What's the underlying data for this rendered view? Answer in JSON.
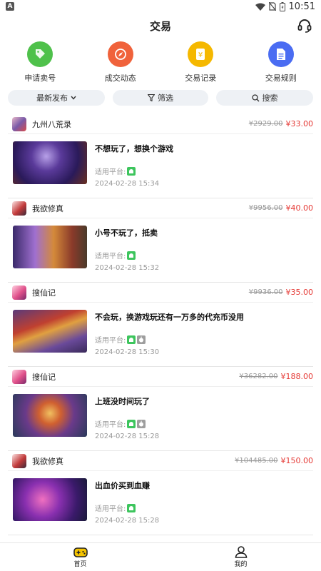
{
  "status": {
    "left_badge": "A",
    "time": "10:51"
  },
  "header": {
    "title": "交易",
    "service_icon": "headset-icon"
  },
  "quick_actions": [
    {
      "label": "申请卖号",
      "icon": "tag-icon",
      "color": "#4fc14b"
    },
    {
      "label": "成交动态",
      "icon": "compass-icon",
      "color": "#f0623b"
    },
    {
      "label": "交易记录",
      "icon": "yen-doc-icon",
      "color": "#f5b800"
    },
    {
      "label": "交易规则",
      "icon": "document-icon",
      "color": "#4a6cf2"
    }
  ],
  "filters": {
    "sort": "最新发布",
    "filter": "筛选",
    "search": "搜索"
  },
  "listings": [
    {
      "game": "九州八荒录",
      "old_price": "¥2929.00",
      "price": "¥33.00",
      "title": "不想玩了，想换个游戏",
      "platform_label": "适用平台:",
      "platforms": [
        "android"
      ],
      "date": "2024-02-28 15:34"
    },
    {
      "game": "我欲修真",
      "old_price": "¥9956.00",
      "price": "¥40.00",
      "title": "小号不玩了，抵卖",
      "platform_label": "适用平台:",
      "platforms": [
        "android"
      ],
      "date": "2024-02-28 15:32"
    },
    {
      "game": "搜仙记",
      "old_price": "¥9936.00",
      "price": "¥35.00",
      "title": "不会玩，换游戏玩还有一万多的代充币没用",
      "platform_label": "适用平台:",
      "platforms": [
        "android",
        "ios"
      ],
      "date": "2024-02-28 15:30"
    },
    {
      "game": "搜仙记",
      "old_price": "¥36282.00",
      "price": "¥188.00",
      "title": "上班没时间玩了",
      "platform_label": "适用平台:",
      "platforms": [
        "android",
        "ios"
      ],
      "date": "2024-02-28 15:28"
    },
    {
      "game": "我欲修真",
      "old_price": "¥104485.00",
      "price": "¥150.00",
      "title": "出血价买到血赚",
      "platform_label": "适用平台:",
      "platforms": [
        "android"
      ],
      "date": "2024-02-28 15:28"
    }
  ],
  "bottom_nav": [
    {
      "label": "首页",
      "icon": "gamepad-icon"
    },
    {
      "label": "我的",
      "icon": "user-icon"
    }
  ]
}
